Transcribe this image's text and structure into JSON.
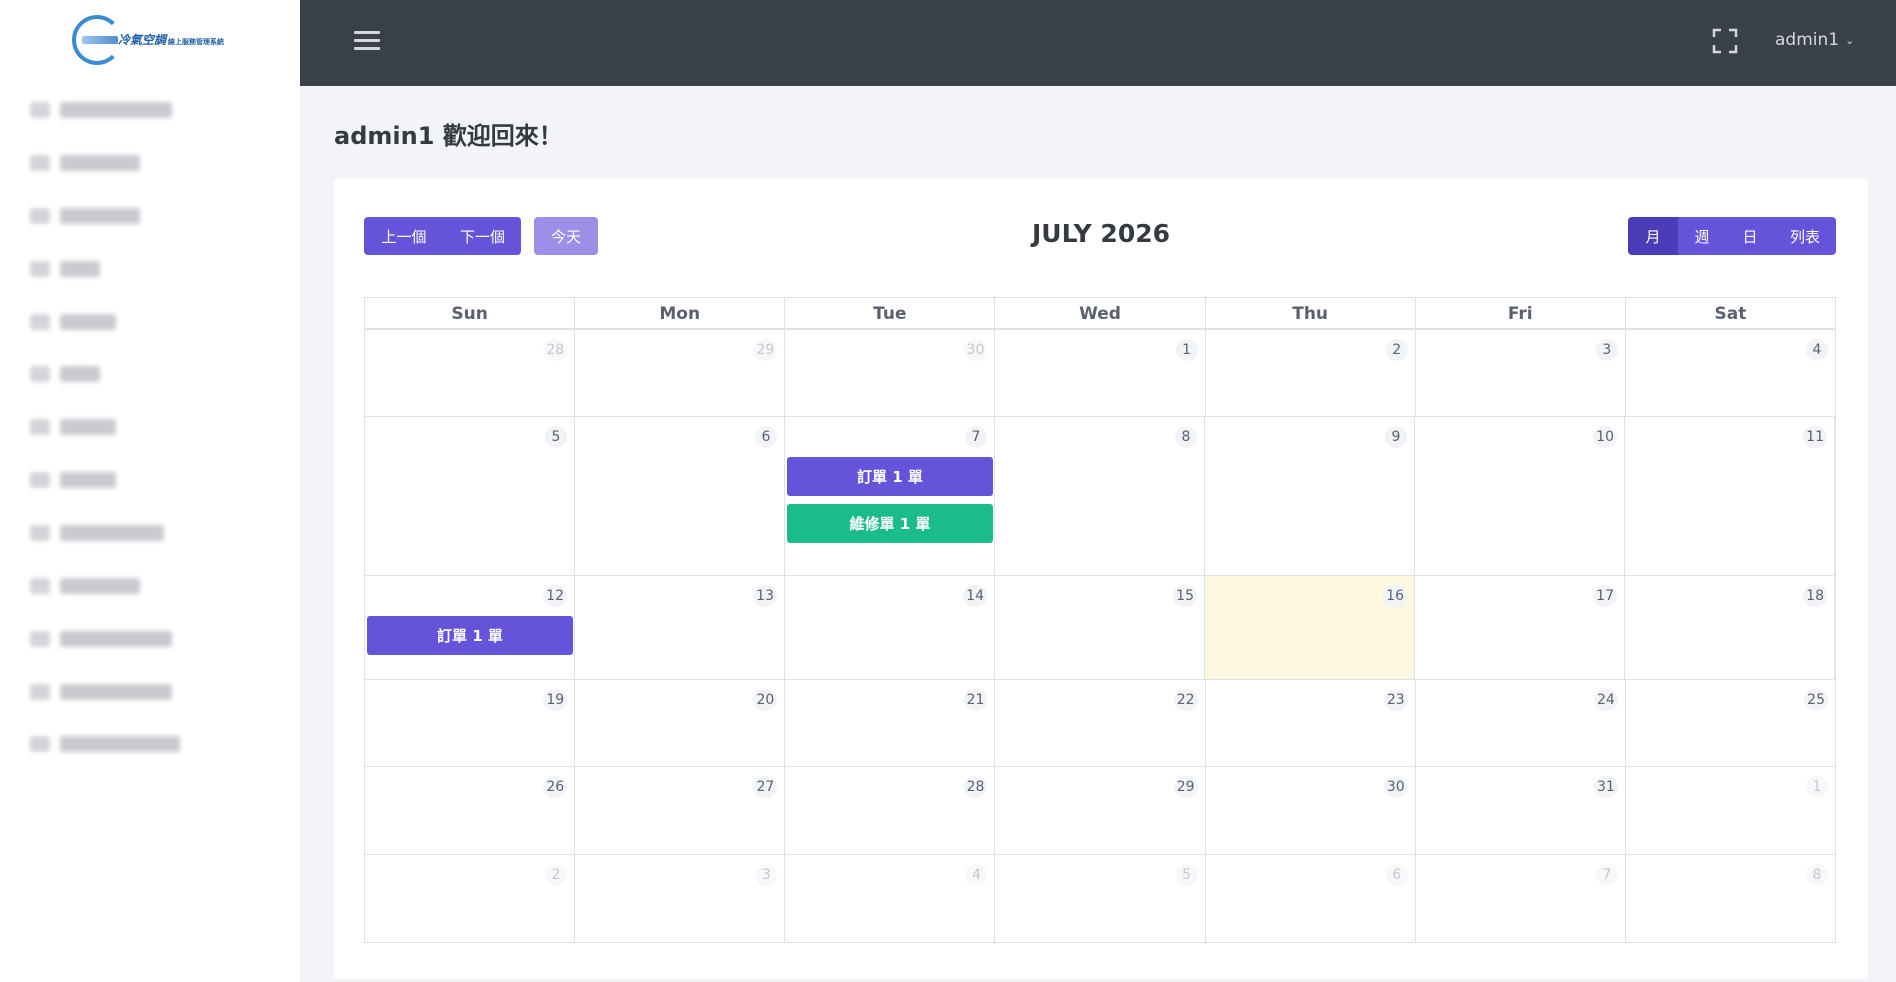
{
  "sidebar": {
    "logo": {
      "title": "冷氣空調",
      "subtitle": "線上服務管理系統"
    },
    "items": [
      {
        "label": "████████",
        "icon": "menu-icon"
      },
      {
        "label": "██████",
        "icon": "menu-icon"
      },
      {
        "label": "██████",
        "icon": "menu-icon"
      },
      {
        "label": "████",
        "icon": "menu-icon"
      },
      {
        "label": "████",
        "icon": "menu-icon"
      },
      {
        "label": "████",
        "icon": "menu-icon"
      },
      {
        "label": "█████",
        "icon": "menu-icon"
      },
      {
        "label": "█████",
        "icon": "menu-icon"
      },
      {
        "label": "███████",
        "icon": "menu-icon"
      },
      {
        "label": "██████",
        "icon": "menu-icon"
      },
      {
        "label": "█████████",
        "icon": "menu-icon"
      },
      {
        "label": "█████████",
        "icon": "menu-icon"
      },
      {
        "label": "█████████",
        "icon": "menu-icon"
      }
    ]
  },
  "topbar": {
    "username": "admin1",
    "hamburger_icon": "hamburger-icon",
    "fullscreen_icon": "fullscreen-icon"
  },
  "welcome": "admin1 歡迎回來！",
  "calendar": {
    "title": "JULY 2026",
    "prev_label": "上一個",
    "next_label": "下一個",
    "today_label": "今天",
    "views": [
      {
        "label": "月",
        "active": true
      },
      {
        "label": "週",
        "active": false
      },
      {
        "label": "日",
        "active": false
      },
      {
        "label": "列表",
        "active": false
      }
    ],
    "dow": [
      "Sun",
      "Mon",
      "Tue",
      "Wed",
      "Thu",
      "Fri",
      "Sat"
    ],
    "weeks": [
      [
        {
          "n": "28",
          "other": true
        },
        {
          "n": "29",
          "other": true
        },
        {
          "n": "30",
          "other": true
        },
        {
          "n": "1"
        },
        {
          "n": "2"
        },
        {
          "n": "3"
        },
        {
          "n": "4"
        }
      ],
      [
        {
          "n": "5"
        },
        {
          "n": "6"
        },
        {
          "n": "7"
        },
        {
          "n": "8"
        },
        {
          "n": "9"
        },
        {
          "n": "10"
        },
        {
          "n": "11"
        }
      ],
      [
        {
          "n": "12"
        },
        {
          "n": "13"
        },
        {
          "n": "14"
        },
        {
          "n": "15"
        },
        {
          "n": "16",
          "today": true
        },
        {
          "n": "17"
        },
        {
          "n": "18"
        }
      ],
      [
        {
          "n": "19"
        },
        {
          "n": "20"
        },
        {
          "n": "21"
        },
        {
          "n": "22"
        },
        {
          "n": "23"
        },
        {
          "n": "24"
        },
        {
          "n": "25"
        }
      ],
      [
        {
          "n": "26"
        },
        {
          "n": "27"
        },
        {
          "n": "28"
        },
        {
          "n": "29"
        },
        {
          "n": "30"
        },
        {
          "n": "31"
        },
        {
          "n": "1",
          "other": true
        }
      ],
      [
        {
          "n": "2",
          "other": true
        },
        {
          "n": "3",
          "other": true
        },
        {
          "n": "4",
          "other": true
        },
        {
          "n": "5",
          "other": true
        },
        {
          "n": "6",
          "other": true
        },
        {
          "n": "7",
          "other": true
        },
        {
          "n": "8",
          "other": true
        }
      ]
    ],
    "events": [
      {
        "week": 1,
        "day": 2,
        "slot": 0,
        "label": "訂單 1 單",
        "type": "order",
        "color": "#6553d9"
      },
      {
        "week": 1,
        "day": 2,
        "slot": 1,
        "label": "維修單 1 單",
        "type": "repair",
        "color": "#1cbb8c"
      },
      {
        "week": 2,
        "day": 0,
        "slot": 0,
        "label": "訂單 1 單",
        "type": "order",
        "color": "#6553d9"
      }
    ]
  },
  "colors": {
    "primary": "#6553d9",
    "primary_active": "#4c3cb8",
    "today_btn": "#9b8fe7",
    "success": "#1cbb8c",
    "topbar": "#394049",
    "today_bg": "#fdf8e1"
  }
}
